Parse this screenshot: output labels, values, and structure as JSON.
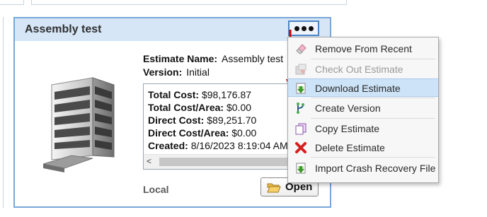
{
  "card": {
    "title": "Assembly test",
    "estimate_name_label": "Estimate Name:",
    "estimate_name_value": "Assembly test",
    "version_label": "Version:",
    "version_value": "Initial",
    "details": [
      {
        "label": "Total Cost:",
        "value": "$98,176.87"
      },
      {
        "label": "Total Cost/Area:",
        "value": "$0.00"
      },
      {
        "label": "Direct Cost:",
        "value": "$89,251.70"
      },
      {
        "label": "Direct Cost/Area:",
        "value": "$0.00"
      },
      {
        "label": "Created:",
        "value": "8/16/2023 8:19:04 AM"
      }
    ],
    "location": "Local",
    "open_label": "Open"
  },
  "menu": {
    "items": [
      {
        "label": "Remove From Recent",
        "icon": "eraser-icon",
        "state": "normal"
      },
      {
        "label": "Check Out Estimate",
        "icon": "checkout-icon",
        "state": "disabled"
      },
      {
        "label": "Download Estimate",
        "icon": "download-icon",
        "state": "hover"
      },
      {
        "label": "Create Version",
        "icon": "branch-icon",
        "state": "normal"
      },
      {
        "label": "Copy Estimate",
        "icon": "copy-icon",
        "state": "normal"
      },
      {
        "label": "Delete Estimate",
        "icon": "delete-icon",
        "state": "normal"
      },
      {
        "label": "Import Crash Recovery File",
        "icon": "import-icon",
        "state": "normal"
      }
    ]
  },
  "colors": {
    "card_border": "#7aa7d8",
    "card_header": "#d6e6f7",
    "menu_hover": "#cde3f7",
    "annotation_arrow": "#cc0000"
  }
}
